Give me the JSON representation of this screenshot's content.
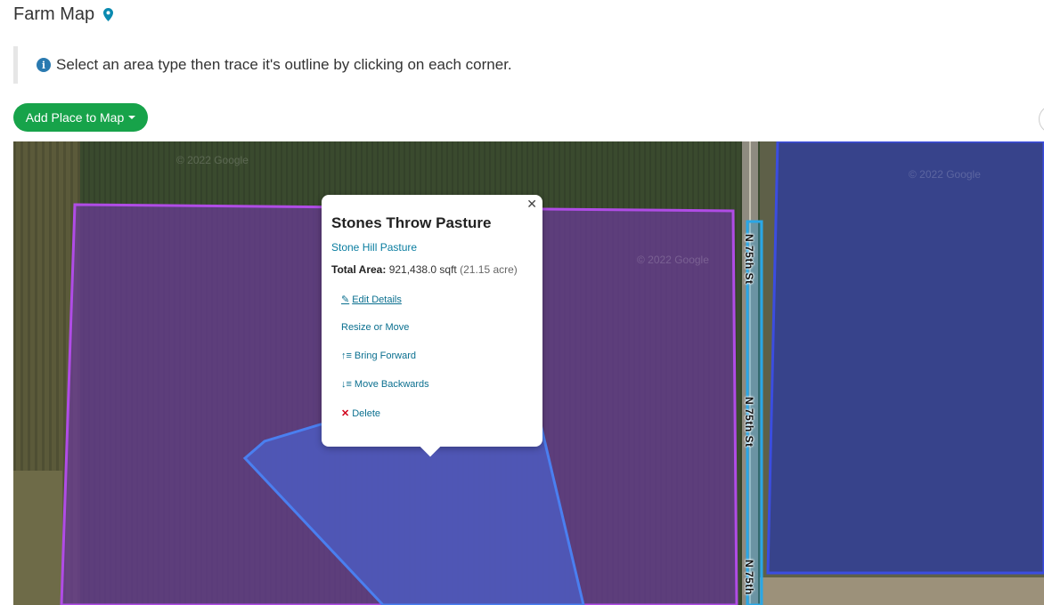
{
  "page": {
    "title": "Farm Map"
  },
  "notice": {
    "text": "Select an area type then trace it's outline by clicking on each corner."
  },
  "toolbar": {
    "add_place_label": "Add Place to Map"
  },
  "map": {
    "road_labels": [
      "N 75th St",
      "N 75th St",
      "N 75th"
    ],
    "watermark": "© 2022 Google",
    "colors": {
      "pasture_outline": "#b04ce6",
      "selected_outline": "#4a7ff0",
      "road_outline": "#2aa7e6",
      "field_outline": "#3b4de0"
    }
  },
  "popup": {
    "title": "Stones Throw Pasture",
    "subtitle": "Stone Hill Pasture",
    "area_label": "Total Area:",
    "area_value": "921,438.0 sqft",
    "area_acre": "(21.15 acre)",
    "actions": {
      "edit": "Edit Details",
      "resize": "Resize or Move",
      "forward": "Bring Forward",
      "backward": "Move Backwards",
      "delete": "Delete"
    }
  },
  "icons": {
    "pin": "map-pin-icon",
    "info": "info-icon",
    "edit": "pencil-icon",
    "forward": "sort-up-icon",
    "backward": "sort-down-icon",
    "delete": "x-icon"
  }
}
